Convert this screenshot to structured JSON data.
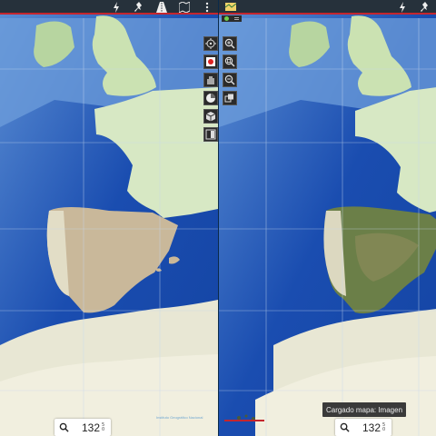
{
  "colors": {
    "topbar": "#26313b",
    "accent_line": "#c4262e",
    "ocean_deep": "#1747a6",
    "ocean_shallow": "#5c8fd4",
    "land_topo": "#cfe6bf",
    "spain_left": "#b0a58a",
    "spain_right": "#5e7a3c"
  },
  "left_pane": {
    "topbar_icons": [
      "lightning-icon",
      "pin-icon",
      "road-icon",
      "map-book-icon",
      "more-icon"
    ],
    "tools": [
      "target-icon",
      "record-icon",
      "hand-icon",
      "compass-icon",
      "cube-icon",
      "layers-icon"
    ],
    "zoom_value": "132",
    "zoom_sub_top": "5",
    "zoom_sub_bottom": "0",
    "attribution": "Instituto Geográfico Nacional"
  },
  "right_pane": {
    "topbar_icons": [
      "map-icon",
      "lightning-icon",
      "pin-icon"
    ],
    "tools": [
      "zoom-in-icon",
      "zoom-area-icon",
      "zoom-out-icon",
      "copy-icon"
    ],
    "zoom_value": "132",
    "zoom_sub_top": "5",
    "zoom_sub_bottom": "0",
    "toast": "Cargado mapa: Imagen"
  }
}
